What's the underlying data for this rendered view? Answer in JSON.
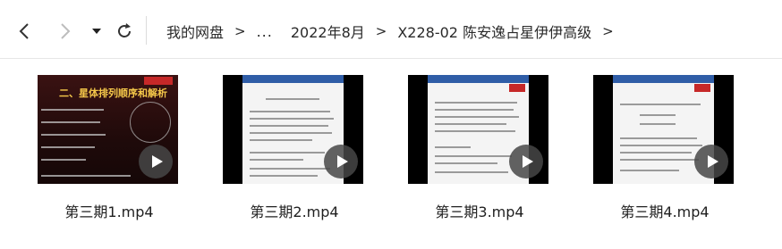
{
  "navigation": {
    "back_icon": "chevron-left-icon",
    "forward_icon": "chevron-right-icon",
    "dropdown_icon": "caret-down-icon",
    "refresh_icon": "refresh-icon"
  },
  "breadcrumb": {
    "root": "我的网盘",
    "ellipsis": "...",
    "items": [
      "2022年8月",
      "X228-02 陈安逸占星伊伊高级"
    ],
    "separator": ">"
  },
  "files": [
    {
      "name": "第三期1.mp4",
      "thumbnail": "slide"
    },
    {
      "name": "第三期2.mp4",
      "thumbnail": "document"
    },
    {
      "name": "第三期3.mp4",
      "thumbnail": "document"
    },
    {
      "name": "第三期4.mp4",
      "thumbnail": "document"
    }
  ],
  "thumbnail_text": {
    "slide_title": "二、星体排列顺序和解析"
  },
  "colors": {
    "toolbar_border": "#e6e6e6",
    "play_overlay": "#464646",
    "doc_header": "#2f5da7",
    "slide_background": "#2a0e0e"
  }
}
